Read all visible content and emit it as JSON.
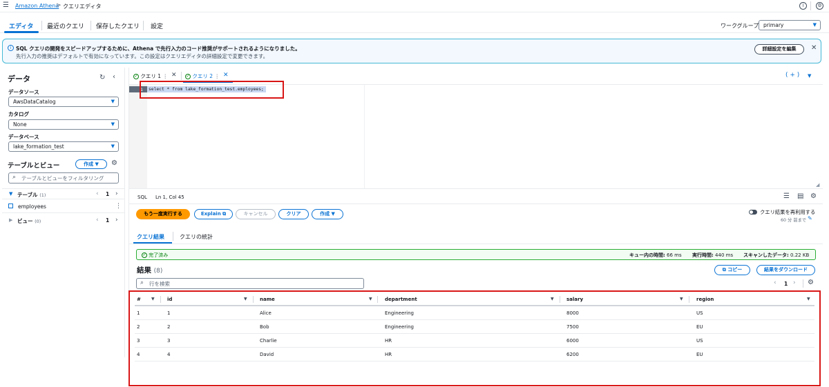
{
  "top": {
    "breadcrumb_home": "Amazon Athena",
    "breadcrumb_sep": ">",
    "breadcrumb_current": "クエリエディタ",
    "info_glyph": "i"
  },
  "nav_tabs": [
    {
      "label": "エディタ",
      "active": true
    },
    {
      "label": "最近のクエリ",
      "active": false
    },
    {
      "label": "保存したクエリ",
      "active": false
    },
    {
      "label": "設定",
      "active": false
    }
  ],
  "workgroup": {
    "label": "ワークグループ",
    "value": "primary"
  },
  "alert": {
    "line1": "SQL クエリの開発をスピードアップするために、Athena で先行入力のコード推奨がサポートされるようになりました。",
    "line2": "先行入力の推奨はデフォルトで有効になっています。この設定はクエリエディタの詳細設定で変更できます。",
    "button": "詳細設定を編集",
    "close": "✕"
  },
  "sidebar": {
    "title": "データ",
    "datasource_label": "データソース",
    "datasource_value": "AwsDataCatalog",
    "catalog_label": "カタログ",
    "catalog_value": "None",
    "database_label": "データベース",
    "database_value": "lake_formation_test",
    "tables_title": "テーブルとビュー",
    "create_button": "作成 ▼",
    "filter_placeholder": "テーブルとビューをフィルタリング",
    "tables_section": "テーブル",
    "tables_count": "(1)",
    "views_section": "ビュー",
    "views_count": "(0)",
    "page_number": "1",
    "table_item": "employees"
  },
  "editor": {
    "tabs": [
      {
        "label": "クエリ 1"
      },
      {
        "label": "クエリ 2"
      }
    ],
    "add_tab": "( + )",
    "line_number": "1",
    "query_text": "select * from lake_formation_test.employees;",
    "status_lang": "SQL",
    "status_pos": "Ln 1, Col 45"
  },
  "actions": {
    "run_again": "もう一度実行する",
    "explain": "Explain",
    "cancel": "キャンセル",
    "clear": "クリア",
    "create": "作成 ▼",
    "reuse_label": "クエリ結果を再利用する",
    "reuse_sub": "60 分 前まで"
  },
  "result_tabs": [
    {
      "label": "クエリ結果",
      "active": true
    },
    {
      "label": "クエリの統計",
      "active": false
    }
  ],
  "status_bar": {
    "status": "完了済み",
    "queue_label": "キュー内の時間:",
    "queue_value": "66 ms",
    "exec_label": "実行時間:",
    "exec_value": "440 ms",
    "scan_label": "スキャンしたデータ:",
    "scan_value": "0.22 KB"
  },
  "results": {
    "title": "結果",
    "count": "(8)",
    "copy_button": "コピー",
    "download_button": "結果をダウンロード",
    "search_placeholder": "行を検索",
    "page_number": "1",
    "columns": [
      "#",
      "id",
      "name",
      "department",
      "salary",
      "region"
    ],
    "rows": [
      [
        "1",
        "1",
        "Alice",
        "Engineering",
        "8000",
        "US"
      ],
      [
        "2",
        "2",
        "Bob",
        "Engineering",
        "7500",
        "EU"
      ],
      [
        "3",
        "3",
        "Charlie",
        "HR",
        "6000",
        "US"
      ],
      [
        "4",
        "4",
        "David",
        "HR",
        "6200",
        "EU"
      ]
    ]
  },
  "colors": {
    "accent": "#0972d3",
    "primary_button": "#ff9900",
    "success": "#037f0c",
    "highlight": "#d91515"
  }
}
